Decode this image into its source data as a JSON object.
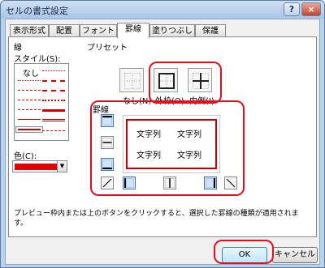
{
  "dialog": {
    "title": "セルの書式設定",
    "help_icon": "?",
    "close_icon": "×"
  },
  "tabs": [
    "表示形式",
    "配置",
    "フォント",
    "罫線",
    "塗りつぶし",
    "保護"
  ],
  "line": {
    "section": "線",
    "style_label": "スタイル(S):",
    "none_label": "なし",
    "color_label": "色(C):",
    "color_value": "#e00000"
  },
  "presets": {
    "section": "プリセット",
    "items": [
      {
        "label": "なし(N)",
        "icon": "border-none-icon"
      },
      {
        "label": "外枠(O)",
        "icon": "border-outline-icon"
      },
      {
        "label": "内側(I)",
        "icon": "border-inside-icon"
      }
    ]
  },
  "border": {
    "section": "罫線",
    "preview_text": [
      "文字列",
      "文字列",
      "文字列",
      "文字列"
    ]
  },
  "hint": "プレビュー枠内または上のボタンをクリックすると、選択した罫線の種類が適用されます。",
  "buttons": {
    "ok": "OK",
    "cancel": "キャンセル"
  },
  "colors": {
    "highlight": "#e01020",
    "line": "#e00000"
  }
}
